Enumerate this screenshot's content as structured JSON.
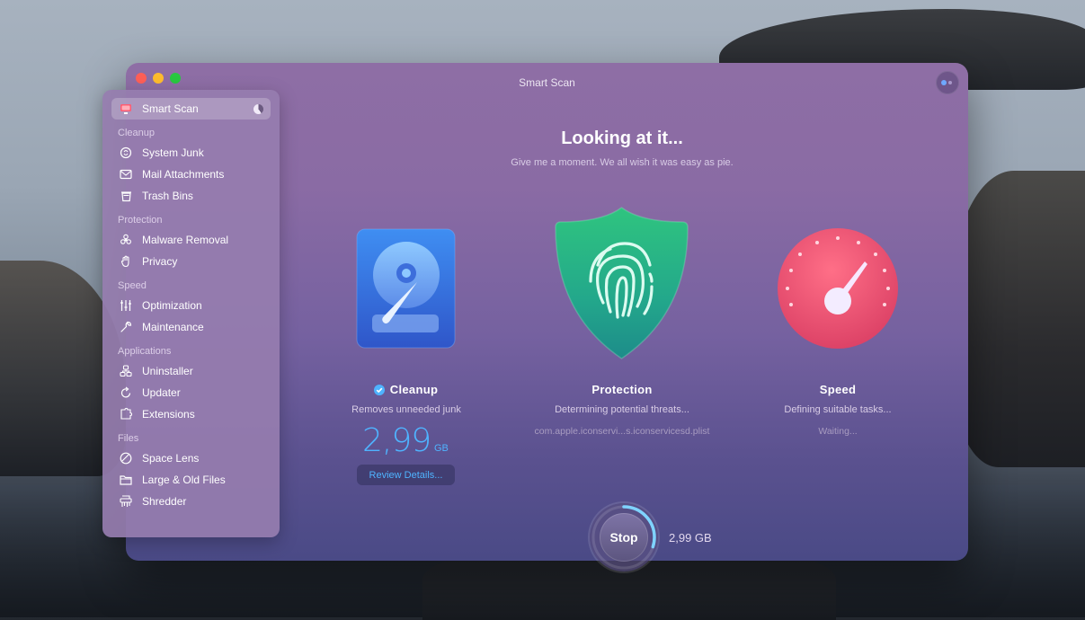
{
  "window": {
    "title": "Smart Scan"
  },
  "sidebar": {
    "active": {
      "label": "Smart Scan",
      "icon": "smart-scan-monitor-icon"
    },
    "sections": [
      {
        "title": "Cleanup",
        "items": [
          {
            "label": "System Junk",
            "icon": "system-junk-icon"
          },
          {
            "label": "Mail Attachments",
            "icon": "mail-icon"
          },
          {
            "label": "Trash Bins",
            "icon": "trash-icon"
          }
        ]
      },
      {
        "title": "Protection",
        "items": [
          {
            "label": "Malware Removal",
            "icon": "biohazard-icon"
          },
          {
            "label": "Privacy",
            "icon": "hand-icon"
          }
        ]
      },
      {
        "title": "Speed",
        "items": [
          {
            "label": "Optimization",
            "icon": "sliders-icon"
          },
          {
            "label": "Maintenance",
            "icon": "wrench-icon"
          }
        ]
      },
      {
        "title": "Applications",
        "items": [
          {
            "label": "Uninstaller",
            "icon": "uninstaller-icon"
          },
          {
            "label": "Updater",
            "icon": "updater-icon"
          },
          {
            "label": "Extensions",
            "icon": "extensions-icon"
          }
        ]
      },
      {
        "title": "Files",
        "items": [
          {
            "label": "Space Lens",
            "icon": "space-lens-icon"
          },
          {
            "label": "Large & Old Files",
            "icon": "folder-icon"
          },
          {
            "label": "Shredder",
            "icon": "shredder-icon"
          }
        ]
      }
    ]
  },
  "main": {
    "headline": "Looking at it...",
    "subline": "Give me a moment. We all wish it was easy as pie.",
    "cleanup": {
      "title": "Cleanup",
      "desc": "Removes unneeded junk",
      "size_value": "2,99",
      "size_unit": "GB",
      "review_label": "Review Details..."
    },
    "protection": {
      "title": "Protection",
      "desc": "Determining potential threats...",
      "file": "com.apple.iconservi...s.iconservicesd.plist"
    },
    "speed": {
      "title": "Speed",
      "desc": "Defining suitable tasks...",
      "status": "Waiting..."
    },
    "stop": {
      "label": "Stop",
      "size": "2,99 GB",
      "progress": 0.3
    }
  },
  "colors": {
    "accent_blue": "#4fb3ff",
    "shield_green": "#2bb58f",
    "speed_pink": "#e8536f",
    "window_purple": "#7c63a2"
  }
}
